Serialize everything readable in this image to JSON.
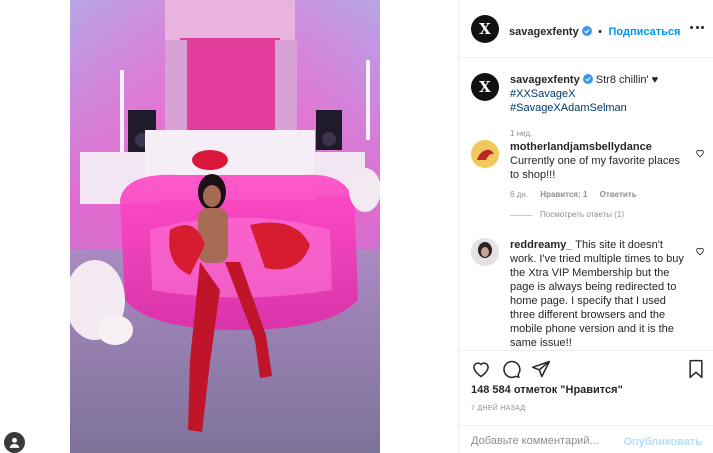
{
  "post": {
    "author": "savagexfenty",
    "follow_label": "Подписаться",
    "dot": "•",
    "more_icon": "more-horizontal-icon",
    "avatar_letter": "X"
  },
  "caption": {
    "username": "savagexfenty",
    "text": "Str8 chillin' ♥",
    "hashtags": "#XXSavageX #SavageXAdamSelman",
    "time": "1 нед."
  },
  "comments": [
    {
      "username": "motherlandjamsbellydance",
      "text": "Currently one of my favorite places to shop!!!",
      "time": "6 дн.",
      "likes": "Нравится: 1",
      "reply": "Ответить",
      "view_replies": "Посмотреть ответы (1)"
    },
    {
      "username": "reddreamy_",
      "text": "This site it doesn't work. I've tried multiple times to buy the Xtra VIP Membership but the page is always being redirected to home page. I specify that I used three different browsers and the mobile phone version and it is the same issue!!"
    }
  ],
  "actions": {
    "likes_text": "148 584 отметок \"Нравится\"",
    "date_text": "7 ДНЕЙ НАЗАД",
    "comment_placeholder": "Добавьте комментарий...",
    "publish_label": "Опубликовать"
  },
  "colors": {
    "link": "#0095f6",
    "verified": "#3897f0",
    "hashtag": "#00376b",
    "muted": "#8e8e8e"
  }
}
